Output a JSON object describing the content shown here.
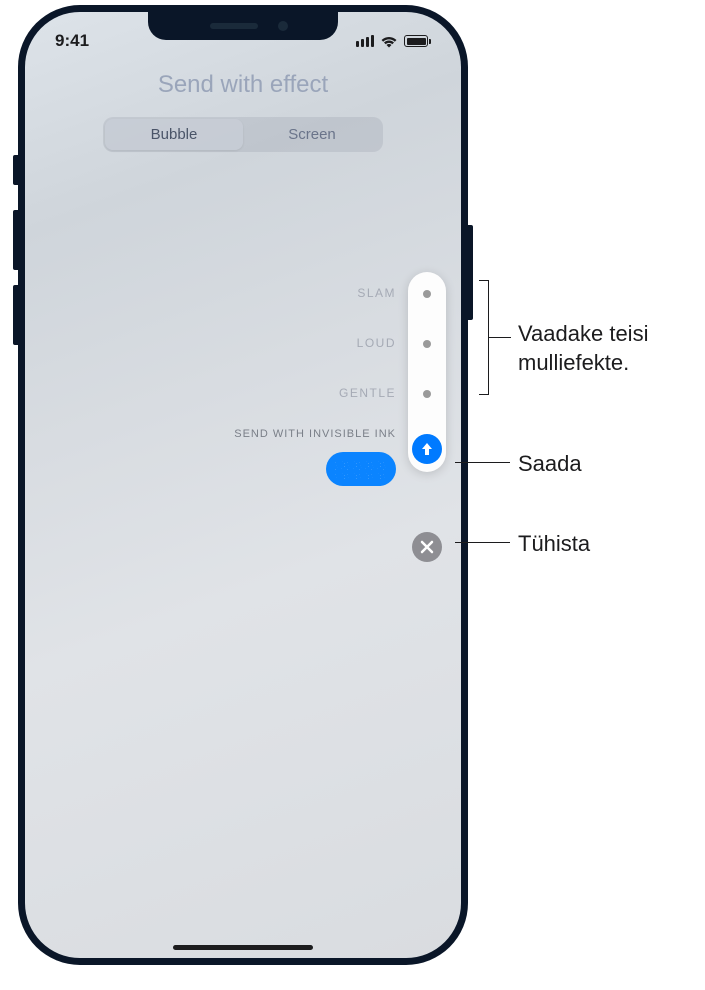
{
  "status_bar": {
    "time": "9:41"
  },
  "header": {
    "title": "Send with effect",
    "tabs": {
      "bubble": "Bubble",
      "screen": "Screen"
    }
  },
  "effects": {
    "slam": "SLAM",
    "loud": "LOUD",
    "gentle": "GENTLE",
    "invisible_ink": "SEND WITH INVISIBLE INK"
  },
  "callouts": {
    "see_other": "Vaadake teisi mulliefekte.",
    "send": "Saada",
    "cancel": "Tühista"
  },
  "colors": {
    "accent_blue": "#007aff",
    "bubble_blue": "#0b84ff",
    "cancel_gray": "#8e8e93"
  }
}
